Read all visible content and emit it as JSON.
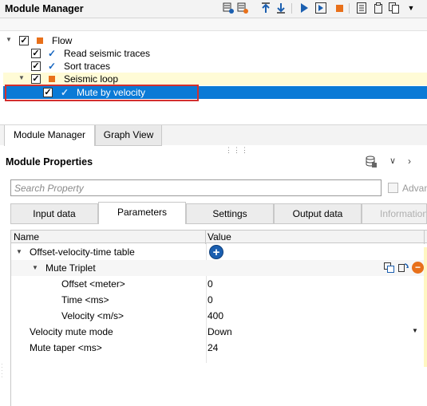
{
  "module_manager": {
    "title": "Module Manager",
    "toolbar_icons": [
      "add-module-icon",
      "remove-module-icon",
      "move-up-icon",
      "move-down-icon",
      "run-icon",
      "run-step-icon",
      "stop-icon",
      "log-icon",
      "clipboard-icon",
      "copy-icon",
      "overflow-menu-icon"
    ],
    "tree": [
      {
        "label": "Flow",
        "checked": true,
        "icon": "flow-square-icon",
        "state": "normal"
      },
      {
        "label": "Read seismic traces",
        "checked": true,
        "icon": "module-check-icon",
        "state": "normal"
      },
      {
        "label": "Sort traces",
        "checked": true,
        "icon": "module-check-icon",
        "state": "normal"
      },
      {
        "label": "Seismic loop",
        "checked": true,
        "icon": "loop-square-icon",
        "state": "yellow"
      },
      {
        "label": "Mute by velocity",
        "checked": true,
        "icon": "module-check-icon",
        "state": "selected"
      }
    ],
    "tabs": [
      "Module Manager",
      "Graph View"
    ],
    "active_tab": "Module Manager"
  },
  "module_properties": {
    "title": "Module Properties",
    "search_placeholder": "Search Property",
    "advanced_label": "Advanced",
    "tabs": [
      "Input data",
      "Parameters",
      "Settings",
      "Output data",
      "Information"
    ],
    "active_tab": "Parameters",
    "columns": [
      "Name",
      "Value"
    ],
    "rows": [
      {
        "name": "Offset-velocity-time table",
        "value": "",
        "level": 0,
        "expanded": true
      },
      {
        "name": "Mute Triplet",
        "value": "",
        "level": 1,
        "expanded": true
      },
      {
        "name": "Offset <meter>",
        "value": "0",
        "level": 2
      },
      {
        "name": "Time <ms>",
        "value": "0",
        "level": 2
      },
      {
        "name": "Velocity <m/s>",
        "value": "400",
        "level": 2
      },
      {
        "name": "Velocity mute mode",
        "value": "Down",
        "level": 0,
        "dropdown": true
      },
      {
        "name": "Mute taper <ms>",
        "value": "24",
        "level": 0
      }
    ]
  },
  "colors": {
    "selection_blue": "#0a7ad6",
    "loop_yellow": "#fffbd6",
    "accent_orange": "#e8701a",
    "highlight_red": "#d32f2f",
    "add_button_blue": "#1b5fb0"
  }
}
